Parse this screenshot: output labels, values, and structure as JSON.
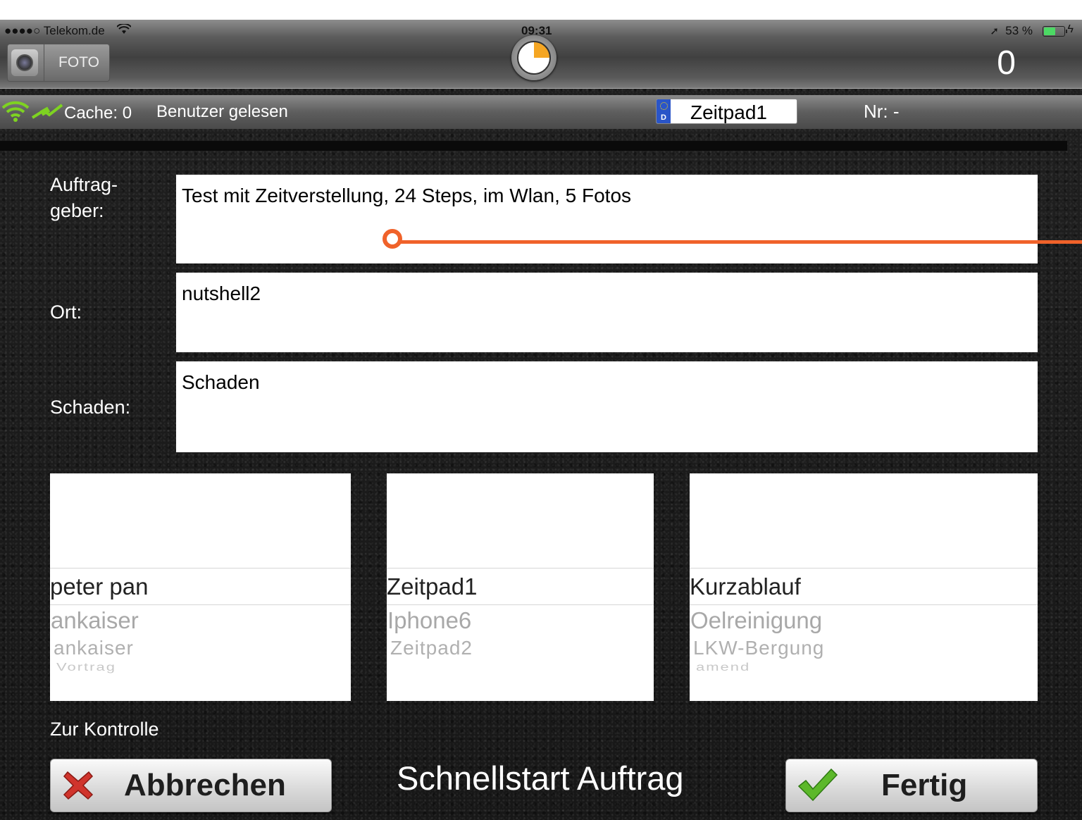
{
  "status_bar": {
    "carrier": "●●●●○ Telekom.de",
    "time": "09:31",
    "battery": "53 %"
  },
  "header": {
    "foto_label": "FOTO",
    "counter": "0"
  },
  "info_bar": {
    "cache": "Cache: 0",
    "user_status": "Benutzer gelesen",
    "plate": "Zeitpad1",
    "nr": "Nr: -"
  },
  "form": {
    "auftraggeber_label_line1": "Auftrag-",
    "auftraggeber_label_line2": "geber:",
    "auftraggeber_value": "Test mit Zeitverstellung, 24 Steps, im Wlan, 5 Fotos",
    "ort_label": "Ort:",
    "ort_value": "nutshell2",
    "schaden_label": "Schaden:",
    "schaden_value": "Schaden"
  },
  "pickers": [
    {
      "selected": "peter pan",
      "rows": [
        "ankaiser",
        "ankaiser",
        "Vortrag"
      ]
    },
    {
      "selected": "Zeitpad1",
      "rows": [
        "Iphone6",
        "Zeitpad2",
        ""
      ]
    },
    {
      "selected": "Kurzablauf",
      "rows": [
        "Oelreinigung",
        "LKW-Bergung",
        "amend"
      ]
    }
  ],
  "footer": {
    "zur_kontrolle": "Zur Kontrolle",
    "cancel": "Abbrechen",
    "title": "Schnellstart Auftrag",
    "done": "Fertig"
  },
  "colors": {
    "accent_orange": "#f0622a",
    "battery_green": "#4cd964",
    "plate_blue": "#2a55c8"
  }
}
